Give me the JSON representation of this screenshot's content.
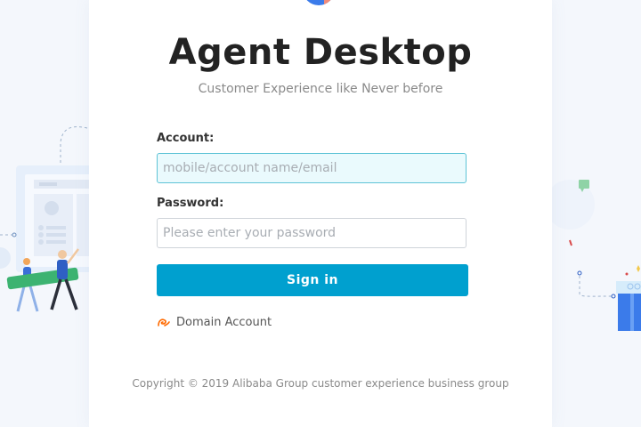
{
  "app": {
    "title": "Agent Desktop",
    "subtitle": "Customer Experience like Never before"
  },
  "form": {
    "account_label": "Account:",
    "account_placeholder": "mobile/account name/email",
    "password_label": "Password:",
    "password_placeholder": "Please enter your password",
    "signin_label": "Sign in",
    "domain_account_label": "Domain Account"
  },
  "footer": {
    "copyright": "Copyright © 2019 Alibaba Group customer experience business group"
  },
  "colors": {
    "primary": "#00a0cf",
    "focused_field_bg": "#eafafd",
    "focused_field_border": "#5ec3d6",
    "domain_icon": "#ff6a00"
  }
}
